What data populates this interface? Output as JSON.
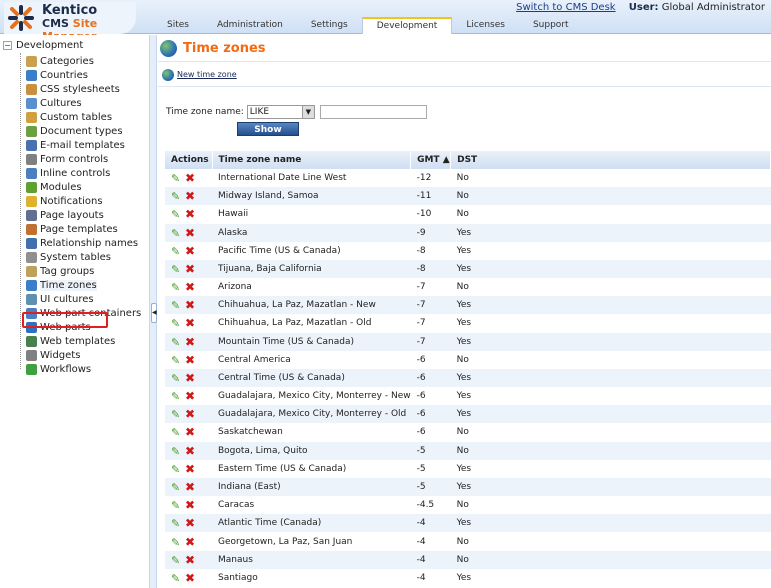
{
  "header": {
    "logo_name": "Kentico",
    "logo_sub1": "CMS",
    "logo_sub2": "Site Manager",
    "switch_link": "Switch to CMS Desk",
    "user_label": "User:",
    "user_name": "Global Administrator",
    "tabs": [
      "Sites",
      "Administration",
      "Settings",
      "Development",
      "Licenses",
      "Support"
    ],
    "active_tab": "Development"
  },
  "sidebar": {
    "root": "Development",
    "selected": "Time zones",
    "items": [
      {
        "label": "Categories",
        "color": "#c8a050"
      },
      {
        "label": "Countries",
        "color": "#3a7fc8"
      },
      {
        "label": "CSS stylesheets",
        "color": "#c89040"
      },
      {
        "label": "Cultures",
        "color": "#5a8fd0"
      },
      {
        "label": "Custom tables",
        "color": "#d0a040"
      },
      {
        "label": "Document types",
        "color": "#6aa040"
      },
      {
        "label": "E-mail templates",
        "color": "#4a70b0"
      },
      {
        "label": "Form controls",
        "color": "#808080"
      },
      {
        "label": "Inline controls",
        "color": "#4a80c0"
      },
      {
        "label": "Modules",
        "color": "#60a030"
      },
      {
        "label": "Notifications",
        "color": "#e0b030"
      },
      {
        "label": "Page layouts",
        "color": "#607090"
      },
      {
        "label": "Page templates",
        "color": "#c07030"
      },
      {
        "label": "Relationship names",
        "color": "#4070b0"
      },
      {
        "label": "System tables",
        "color": "#909090"
      },
      {
        "label": "Tag groups",
        "color": "#c0a060"
      },
      {
        "label": "Time zones",
        "color": "#3a7fc8"
      },
      {
        "label": "UI cultures",
        "color": "#6090b0"
      },
      {
        "label": "Web part containers",
        "color": "#4a80c0"
      },
      {
        "label": "Web parts",
        "color": "#3070c0"
      },
      {
        "label": "Web templates",
        "color": "#4a8050"
      },
      {
        "label": "Widgets",
        "color": "#808080"
      },
      {
        "label": "Workflows",
        "color": "#40a040"
      }
    ]
  },
  "main": {
    "title": "Time zones",
    "new_link": "New time zone",
    "filter": {
      "label": "Time zone name:",
      "operator": "LIKE",
      "value": "",
      "show_button": "Show"
    },
    "columns": [
      "Actions",
      "Time zone name",
      "GMT ▲",
      "DST"
    ],
    "rows": [
      [
        "International Date Line West",
        "-12",
        "No"
      ],
      [
        "Midway Island, Samoa",
        "-11",
        "No"
      ],
      [
        "Hawaii",
        "-10",
        "No"
      ],
      [
        "Alaska",
        "-9",
        "Yes"
      ],
      [
        "Pacific Time (US & Canada)",
        "-8",
        "Yes"
      ],
      [
        "Tijuana, Baja California",
        "-8",
        "Yes"
      ],
      [
        "Arizona",
        "-7",
        "No"
      ],
      [
        "Chihuahua, La Paz, Mazatlan - New",
        "-7",
        "Yes"
      ],
      [
        "Chihuahua, La Paz, Mazatlan - Old",
        "-7",
        "Yes"
      ],
      [
        "Mountain Time (US & Canada)",
        "-7",
        "Yes"
      ],
      [
        "Central America",
        "-6",
        "No"
      ],
      [
        "Central Time (US & Canada)",
        "-6",
        "Yes"
      ],
      [
        "Guadalajara, Mexico City, Monterrey - New",
        "-6",
        "Yes"
      ],
      [
        "Guadalajara, Mexico City, Monterrey - Old",
        "-6",
        "Yes"
      ],
      [
        "Saskatchewan",
        "-6",
        "No"
      ],
      [
        "Bogota, Lima, Quito",
        "-5",
        "No"
      ],
      [
        "Eastern Time (US & Canada)",
        "-5",
        "Yes"
      ],
      [
        "Indiana (East)",
        "-5",
        "Yes"
      ],
      [
        "Caracas",
        "-4.5",
        "No"
      ],
      [
        "Atlantic Time (Canada)",
        "-4",
        "Yes"
      ],
      [
        "Georgetown, La Paz, San Juan",
        "-4",
        "No"
      ],
      [
        "Manaus",
        "-4",
        "No"
      ],
      [
        "Santiago",
        "-4",
        "Yes"
      ]
    ]
  }
}
